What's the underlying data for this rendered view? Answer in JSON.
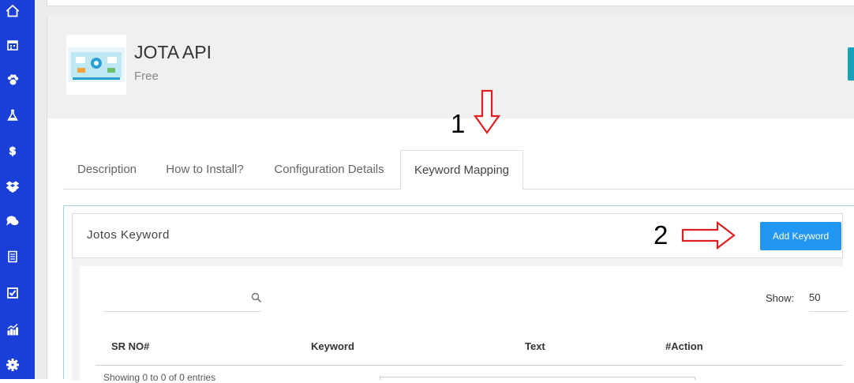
{
  "sidebar": {
    "items": [
      {
        "icon": "home-icon"
      },
      {
        "icon": "calendar-icon"
      },
      {
        "icon": "paw-icon"
      },
      {
        "icon": "flask-icon"
      },
      {
        "icon": "dollar-icon"
      },
      {
        "icon": "dropbox-icon"
      },
      {
        "icon": "chat-icon"
      },
      {
        "icon": "document-icon"
      },
      {
        "icon": "checkbox-icon"
      },
      {
        "icon": "chart-icon"
      },
      {
        "icon": "gear-icon"
      }
    ]
  },
  "app": {
    "title": "JOTA API",
    "subtitle": "Free"
  },
  "annotations": {
    "step1": "1",
    "step2": "2"
  },
  "tabs": [
    {
      "label": "Description",
      "active": false
    },
    {
      "label": "How to Install?",
      "active": false
    },
    {
      "label": "Configuration Details",
      "active": false
    },
    {
      "label": "Keyword Mapping",
      "active": true
    }
  ],
  "panel": {
    "title": "Jotos Keyword",
    "add_button": "Add Keyword"
  },
  "search": {
    "value": "",
    "placeholder": ""
  },
  "show": {
    "label": "Show:",
    "value": "50"
  },
  "table": {
    "headers": [
      "SR NO#",
      "Keyword",
      "Text",
      "#Action"
    ]
  },
  "footer": {
    "showing": "Showing 0 to 0 of 0 entries"
  },
  "colors": {
    "sidebar": "#1a3fd8",
    "button": "#2196f3",
    "annotation_arrow": "#e02020",
    "teal_accent": "#17a2b8"
  }
}
